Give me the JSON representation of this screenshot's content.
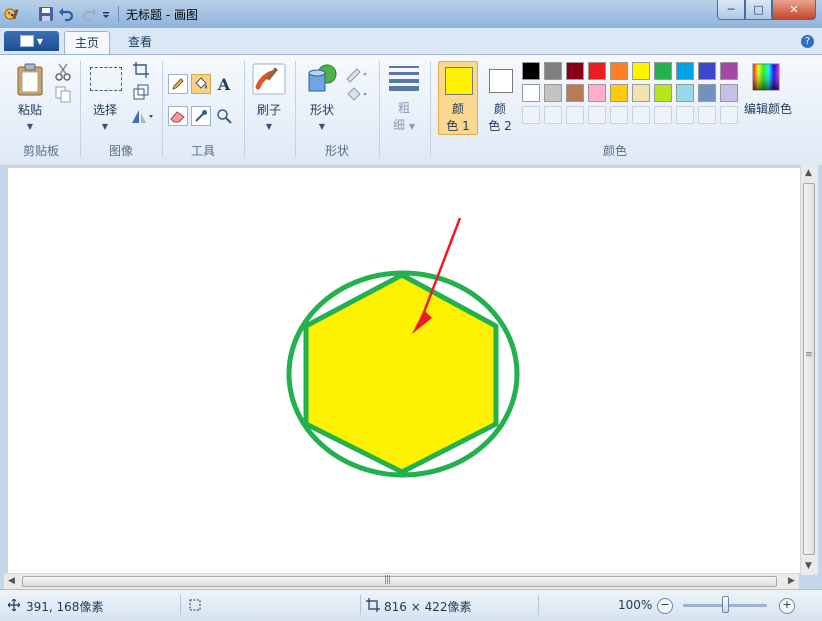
{
  "window": {
    "title": "无标题 - 画图",
    "minimize_glyph": "─",
    "maximize_glyph": "□",
    "close_glyph": "✕"
  },
  "quick_access": {
    "icons": [
      "paint-app-icon",
      "save-icon",
      "undo-icon",
      "redo-icon",
      "customize-dropdown-icon"
    ]
  },
  "tabs": {
    "home": "主页",
    "view": "查看",
    "help_glyph": "?"
  },
  "ribbon": {
    "clipboard": {
      "paste": "粘贴",
      "group": "剪贴板"
    },
    "image": {
      "select": "选择",
      "group": "图像"
    },
    "tools": {
      "group": "工具",
      "text_glyph": "A"
    },
    "brushes": {
      "label": "刷子"
    },
    "shapes": {
      "label": "形状",
      "group": "形状"
    },
    "size": {
      "line1": "粗",
      "line2": "细"
    },
    "colors": {
      "color1_line1": "颜",
      "color1_line2": "色 1",
      "color2_line1": "颜",
      "color2_line2": "色 2",
      "edit_colors": "编辑颜色",
      "group": "颜色",
      "color1_value": "#fff200",
      "color2_value": "#ffffff",
      "palette_row1": [
        "#000000",
        "#7f7f7f",
        "#880015",
        "#ed1c24",
        "#ff7f27",
        "#fff200",
        "#22b14c",
        "#00a2e8",
        "#3f48cc",
        "#a349a4"
      ],
      "palette_row2": [
        "#ffffff",
        "#c3c3c3",
        "#b97a57",
        "#ffaec9",
        "#ffc90e",
        "#efe4b0",
        "#b5e61d",
        "#99d9ea",
        "#7092be",
        "#c8bfe7"
      ]
    }
  },
  "canvas": {
    "drawing": {
      "circle_color": "#22b14c",
      "hexagon_fill": "#fff200",
      "arrow_color": "#ed1c24"
    }
  },
  "statusbar": {
    "cursor_pos": "391, 168像素",
    "image_size": "816 × 422像素",
    "zoom": "100%",
    "zoom_out": "−",
    "zoom_in": "+"
  }
}
